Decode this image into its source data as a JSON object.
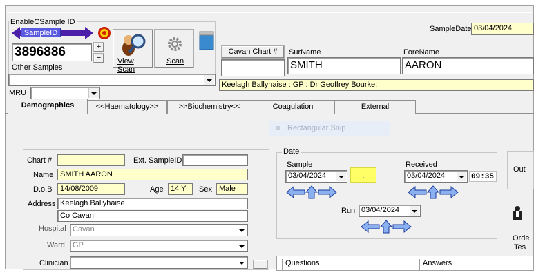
{
  "sample_id_frame": {
    "legend": "EnableCSample ID",
    "sample_id_label": "SampleID",
    "sample_id_value": "3896886",
    "other_samples_label": "Other Samples",
    "view_scan_label": "View Scan",
    "scan_label": "Scan",
    "mru_label": "MRU",
    "plus": "+",
    "minus": "−"
  },
  "header": {
    "sample_date_label": "SampleDate",
    "sample_date_value": "03/04/2024",
    "chart_button_label": "Cavan Chart #",
    "surname_label": "SurName",
    "surname_value": "SMITH",
    "forename_label": "ForeName",
    "forename_value": "AARON",
    "info_line": "Keelagh Ballyhaise : GP : Dr Geoffrey Bourke:"
  },
  "tabs": [
    {
      "label": "Demographics",
      "active": true
    },
    {
      "label": "<<Haematology>>",
      "active": false
    },
    {
      "label": ">>Biochemistry<<",
      "active": false
    },
    {
      "label": "Coagulation",
      "active": false
    },
    {
      "label": "External",
      "active": false
    }
  ],
  "snip_overlay": {
    "label": "Rectangular Snip"
  },
  "demographics": {
    "chart_label": "Chart #",
    "chart_value": "",
    "ext_sample_label": "Ext. SampleID",
    "ext_sample_value": "",
    "name_label": "Name",
    "name_value": "SMITH AARON",
    "dob_label": "D.o.B",
    "dob_value": "14/08/2009",
    "age_label": "Age",
    "age_value": "14 Y",
    "sex_label": "Sex",
    "sex_value": "Male",
    "address_label": "Address",
    "address_line1": "Keelagh Ballyhaise",
    "address_line2": "Co Cavan",
    "hospital_label": "Hospital",
    "hospital_value": "Cavan",
    "ward_label": "Ward",
    "ward_value": "GP",
    "clinician_label": "Clinician",
    "clinician_value": ""
  },
  "date_frame": {
    "legend": "Date",
    "sample_label": "Sample",
    "sample_value": "03/04/2024",
    "time_value": ":",
    "received_label": "Received",
    "received_value": "03/04/2024",
    "received_time": "09:35",
    "run_label": "Run",
    "run_value": "03/04/2024"
  },
  "right_panel": {
    "out_label": "Out",
    "order_label": "Orde",
    "tests_label": "Tes"
  },
  "questions_table": {
    "col_questions": "Questions",
    "col_answers": "Answers"
  },
  "colors": {
    "accent_purple": "#4b1fa8",
    "highlight_yellow": "#ffff66",
    "field_yellow": "#ffffcc"
  }
}
